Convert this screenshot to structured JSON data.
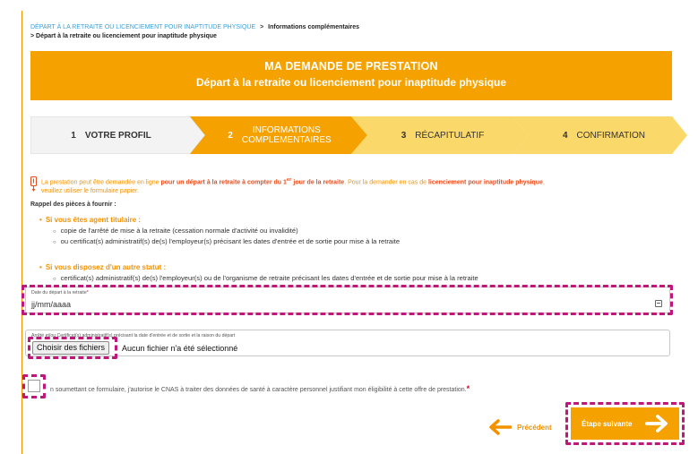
{
  "breadcrumb": {
    "link": "DÉPART À LA RETRAITE OU LICENCIEMENT POUR INAPTITUDE PHYSIQUE",
    "sep1": ">",
    "current": "Informations complémentaires",
    "sep2": ">",
    "second_line": "Départ à la retraite ou licenciement pour inaptitude physique"
  },
  "banner": {
    "title": "MA DEMANDE DE PRESTATION",
    "subtitle": "Départ à la retraite ou licenciement pour inaptitude physique"
  },
  "steps": [
    {
      "num": "1",
      "label": "VOTRE PROFIL"
    },
    {
      "num": "2",
      "label_l1": "INFORMATIONS",
      "label_l2": "COMPLEMENTAIRES"
    },
    {
      "num": "3",
      "label": "RÉCAPITULATIF"
    },
    {
      "num": "4",
      "label": "CONFIRMATION"
    }
  ],
  "info": {
    "p1": "La prestation peut être demandée en ligne ",
    "b1": "pour un départ à la retraite à compter du 1",
    "sup": "er",
    "b1_end": " jour de la retraite",
    "p2": ". Pour la demander en cas de ",
    "b2": "licenciement pour inaptitude physique",
    "p3": ",",
    "p4": "veuillez utiliser le formulaire papier."
  },
  "reminder_title": "Rappel des pièces à fournir :",
  "groups": [
    {
      "title": "Si vous êtes agent titulaire :",
      "items": [
        "copie de l'arrêté de mise à la retraite (cessation normale d'activité ou invalidité)",
        "ou certificat(s) administratif(s) de(s) l'employeur(s) précisant les dates d'entrée et de sortie pour mise à la retraite"
      ]
    },
    {
      "title": "Si vous disposez d'un autre statut :",
      "items": [
        "certificat(s) administratif(s) de(s) l'employeur(s) ou de l'organisme de retraite précisant les dates d'entrée et de sortie pour mise à la retraite"
      ]
    }
  ],
  "date_field": {
    "label": "Date du départ à la retraite",
    "required_mark": "*",
    "value": "jj/mm/aaaa"
  },
  "file_field": {
    "label": "Arrêté et/ou Certificat(s) administratif(s) précisant la date d'entrée et de sortie et la raison du départ",
    "button": "Choisir des fichiers",
    "status": "Aucun fichier n'a été sélectionné"
  },
  "consent": {
    "text": "n soumettant ce formulaire, j'autorise le CNAS à traiter des données de santé à caractère personnel justifiant mon éligibilité à cette offre de prestation.",
    "required_mark": "*"
  },
  "nav": {
    "prev_label": "Précédent",
    "next_label": "Étape suivante"
  },
  "colors": {
    "accent": "#f5a200",
    "step_light": "#fbd86a",
    "link_blue": "#3aa0d8",
    "highlight": "#c0177a",
    "required": "#e2001a"
  }
}
